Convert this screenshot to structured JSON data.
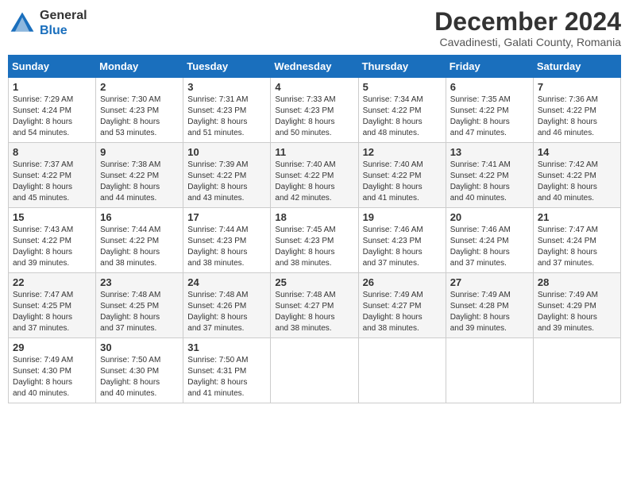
{
  "header": {
    "logo_line1": "General",
    "logo_line2": "Blue",
    "month_title": "December 2024",
    "subtitle": "Cavadinesti, Galati County, Romania"
  },
  "weekdays": [
    "Sunday",
    "Monday",
    "Tuesday",
    "Wednesday",
    "Thursday",
    "Friday",
    "Saturday"
  ],
  "weeks": [
    [
      {
        "day": "1",
        "info": "Sunrise: 7:29 AM\nSunset: 4:24 PM\nDaylight: 8 hours\nand 54 minutes."
      },
      {
        "day": "2",
        "info": "Sunrise: 7:30 AM\nSunset: 4:23 PM\nDaylight: 8 hours\nand 53 minutes."
      },
      {
        "day": "3",
        "info": "Sunrise: 7:31 AM\nSunset: 4:23 PM\nDaylight: 8 hours\nand 51 minutes."
      },
      {
        "day": "4",
        "info": "Sunrise: 7:33 AM\nSunset: 4:23 PM\nDaylight: 8 hours\nand 50 minutes."
      },
      {
        "day": "5",
        "info": "Sunrise: 7:34 AM\nSunset: 4:22 PM\nDaylight: 8 hours\nand 48 minutes."
      },
      {
        "day": "6",
        "info": "Sunrise: 7:35 AM\nSunset: 4:22 PM\nDaylight: 8 hours\nand 47 minutes."
      },
      {
        "day": "7",
        "info": "Sunrise: 7:36 AM\nSunset: 4:22 PM\nDaylight: 8 hours\nand 46 minutes."
      }
    ],
    [
      {
        "day": "8",
        "info": "Sunrise: 7:37 AM\nSunset: 4:22 PM\nDaylight: 8 hours\nand 45 minutes."
      },
      {
        "day": "9",
        "info": "Sunrise: 7:38 AM\nSunset: 4:22 PM\nDaylight: 8 hours\nand 44 minutes."
      },
      {
        "day": "10",
        "info": "Sunrise: 7:39 AM\nSunset: 4:22 PM\nDaylight: 8 hours\nand 43 minutes."
      },
      {
        "day": "11",
        "info": "Sunrise: 7:40 AM\nSunset: 4:22 PM\nDaylight: 8 hours\nand 42 minutes."
      },
      {
        "day": "12",
        "info": "Sunrise: 7:40 AM\nSunset: 4:22 PM\nDaylight: 8 hours\nand 41 minutes."
      },
      {
        "day": "13",
        "info": "Sunrise: 7:41 AM\nSunset: 4:22 PM\nDaylight: 8 hours\nand 40 minutes."
      },
      {
        "day": "14",
        "info": "Sunrise: 7:42 AM\nSunset: 4:22 PM\nDaylight: 8 hours\nand 40 minutes."
      }
    ],
    [
      {
        "day": "15",
        "info": "Sunrise: 7:43 AM\nSunset: 4:22 PM\nDaylight: 8 hours\nand 39 minutes."
      },
      {
        "day": "16",
        "info": "Sunrise: 7:44 AM\nSunset: 4:22 PM\nDaylight: 8 hours\nand 38 minutes."
      },
      {
        "day": "17",
        "info": "Sunrise: 7:44 AM\nSunset: 4:23 PM\nDaylight: 8 hours\nand 38 minutes."
      },
      {
        "day": "18",
        "info": "Sunrise: 7:45 AM\nSunset: 4:23 PM\nDaylight: 8 hours\nand 38 minutes."
      },
      {
        "day": "19",
        "info": "Sunrise: 7:46 AM\nSunset: 4:23 PM\nDaylight: 8 hours\nand 37 minutes."
      },
      {
        "day": "20",
        "info": "Sunrise: 7:46 AM\nSunset: 4:24 PM\nDaylight: 8 hours\nand 37 minutes."
      },
      {
        "day": "21",
        "info": "Sunrise: 7:47 AM\nSunset: 4:24 PM\nDaylight: 8 hours\nand 37 minutes."
      }
    ],
    [
      {
        "day": "22",
        "info": "Sunrise: 7:47 AM\nSunset: 4:25 PM\nDaylight: 8 hours\nand 37 minutes."
      },
      {
        "day": "23",
        "info": "Sunrise: 7:48 AM\nSunset: 4:25 PM\nDaylight: 8 hours\nand 37 minutes."
      },
      {
        "day": "24",
        "info": "Sunrise: 7:48 AM\nSunset: 4:26 PM\nDaylight: 8 hours\nand 37 minutes."
      },
      {
        "day": "25",
        "info": "Sunrise: 7:48 AM\nSunset: 4:27 PM\nDaylight: 8 hours\nand 38 minutes."
      },
      {
        "day": "26",
        "info": "Sunrise: 7:49 AM\nSunset: 4:27 PM\nDaylight: 8 hours\nand 38 minutes."
      },
      {
        "day": "27",
        "info": "Sunrise: 7:49 AM\nSunset: 4:28 PM\nDaylight: 8 hours\nand 39 minutes."
      },
      {
        "day": "28",
        "info": "Sunrise: 7:49 AM\nSunset: 4:29 PM\nDaylight: 8 hours\nand 39 minutes."
      }
    ],
    [
      {
        "day": "29",
        "info": "Sunrise: 7:49 AM\nSunset: 4:30 PM\nDaylight: 8 hours\nand 40 minutes."
      },
      {
        "day": "30",
        "info": "Sunrise: 7:50 AM\nSunset: 4:30 PM\nDaylight: 8 hours\nand 40 minutes."
      },
      {
        "day": "31",
        "info": "Sunrise: 7:50 AM\nSunset: 4:31 PM\nDaylight: 8 hours\nand 41 minutes."
      },
      null,
      null,
      null,
      null
    ]
  ]
}
